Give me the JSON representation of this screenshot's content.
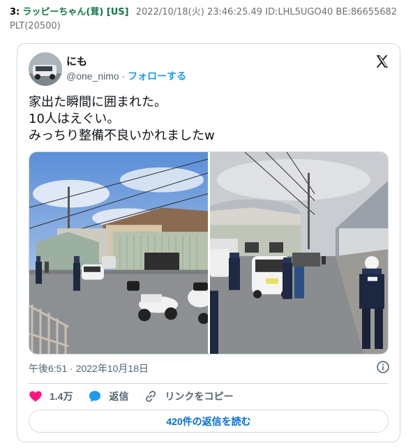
{
  "post": {
    "number": "3:",
    "poster_name": "ラッピーちゃん(茸) [US]",
    "date": "2022/10/18(火) 23:46:25.49 ID:LHL5UGO40 BE:86655682",
    "line2": "PLT(20500)"
  },
  "tweet": {
    "display_name": "にも",
    "handle": "@one_nimo",
    "separator": " · ",
    "follow_label": "フォローする",
    "text_lines": [
      "家出た瞬間に囲まれた。",
      "10人はえぐい。",
      "みっちり整備不良いかれましたw"
    ],
    "timestamp": "午後6:51 · 2022年10月18日",
    "actions": {
      "likes": "1.4万",
      "reply_label": "返信",
      "copy_link_label": "リンクをコピー"
    },
    "read_replies_label": "420件の返信を読む"
  },
  "colors": {
    "poster_name": "#117743",
    "link_blue": "#1d9bf0",
    "like_pink": "#f91880",
    "border": "#cfd9de"
  },
  "icons": [
    "x-logo-icon",
    "info-icon",
    "heart-icon",
    "reply-bubble-icon",
    "link-icon"
  ]
}
